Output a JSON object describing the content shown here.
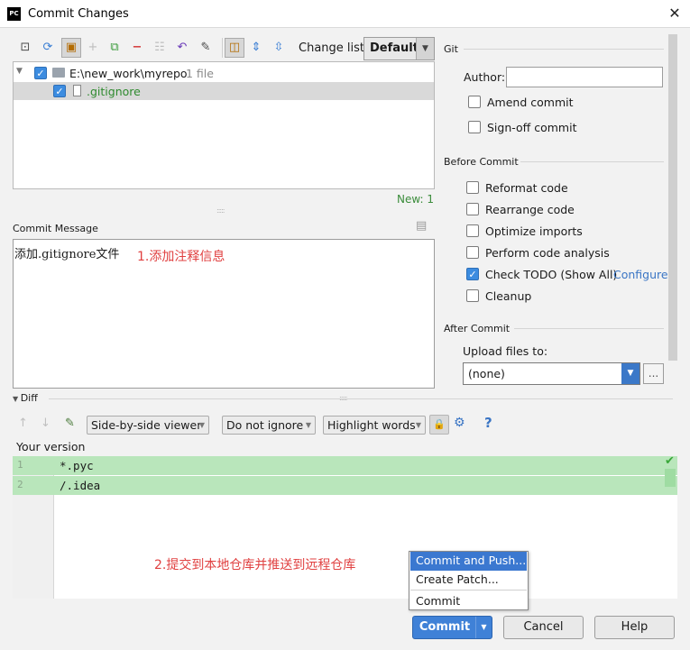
{
  "window": {
    "app_icon": "PC",
    "title": "Commit Changes",
    "close_glyph": "✕"
  },
  "toolbar": {
    "icons": [
      "diff-icon",
      "refresh-icon",
      "shelve-icon",
      "add-icon",
      "move-icon",
      "remove-icon",
      "group-icon",
      "revert-icon",
      "edit-icon",
      "select-changelist-icon",
      "expand-all-icon",
      "collapse-all-icon"
    ],
    "changelist_label": "Change list:",
    "changelist_value": "Default"
  },
  "tree": {
    "repo_path": "E:\\new_work\\myrepo",
    "repo_count": "1 file",
    "file_name": ".gitignore",
    "new_count": "New: 1"
  },
  "commit_message": {
    "label": "Commit Message",
    "text": "添加.gitignore文件",
    "annotation": "1.添加注释信息"
  },
  "git": {
    "section": "Git",
    "author_label": "Author:",
    "author_value": "",
    "amend": "Amend commit",
    "signoff": "Sign-off commit"
  },
  "before_commit": {
    "section": "Before Commit",
    "options": [
      {
        "label": "Reformat code",
        "checked": false
      },
      {
        "label": "Rearrange code",
        "checked": false
      },
      {
        "label": "Optimize imports",
        "checked": false
      },
      {
        "label": "Perform code analysis",
        "checked": false
      },
      {
        "label": "Check TODO (Show All)",
        "checked": true
      },
      {
        "label": "Cleanup",
        "checked": false
      }
    ],
    "configure": "Configure"
  },
  "after_commit": {
    "section": "After Commit",
    "upload_label": "Upload files to:",
    "upload_value": "(none)",
    "more": "..."
  },
  "diff": {
    "header": "Diff",
    "viewer": "Side-by-side viewer",
    "ignore": "Do not ignore",
    "highlight": "Highlight words",
    "help": "?",
    "your_version": "Your version",
    "lines": [
      {
        "num": "1",
        "text": "*.pyc"
      },
      {
        "num": "2",
        "text": "/.idea"
      }
    ],
    "annotation": "2.提交到本地仓库并推送到远程仓库"
  },
  "popup": {
    "commit_and_push": "Commit and Push...",
    "create_patch": "Create Patch...",
    "commit": "Commit"
  },
  "buttons": {
    "commit": "Commit",
    "cancel": "Cancel",
    "help": "Help"
  },
  "colors": {
    "accent": "#3b78d0",
    "new_green": "#3b8c3b",
    "annotation_red": "#e04040",
    "diff_added": "#b9e6bb"
  }
}
